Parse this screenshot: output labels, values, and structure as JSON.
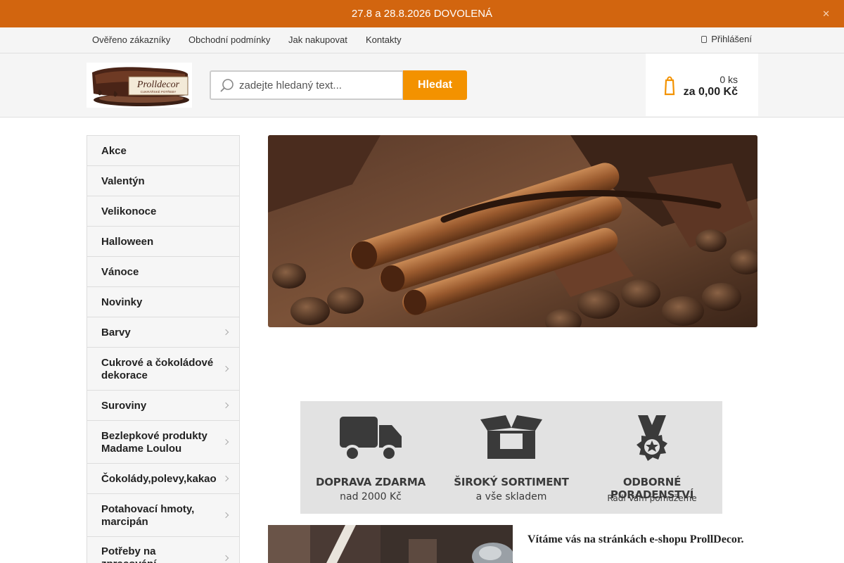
{
  "announcement": {
    "text": "27.8 a 28.8.2026 DOVOLENÁ",
    "close_icon": "close-icon"
  },
  "topnav": {
    "links": [
      "Ověřeno zákazníky",
      "Obchodní podmínky",
      "Jak nakupovat",
      "Kontakty"
    ],
    "login_label": "Přihlášení"
  },
  "header": {
    "logo_text": "Prolldecor",
    "logo_tagline": "CUKRÁŘSKÉ POTŘEBY",
    "search_placeholder": "zadejte hledaný text...",
    "search_button": "Hledat",
    "cart_qty": "0 ks",
    "cart_total": "za 0,00 Kč"
  },
  "sidebar": {
    "items": [
      {
        "label": "Akce",
        "has_sub": false
      },
      {
        "label": "Valentýn",
        "has_sub": false
      },
      {
        "label": "Velikonoce",
        "has_sub": false
      },
      {
        "label": "Halloween",
        "has_sub": false
      },
      {
        "label": "Vánoce",
        "has_sub": false
      },
      {
        "label": "Novinky",
        "has_sub": false
      },
      {
        "label": "Barvy",
        "has_sub": true
      },
      {
        "label": "Cukrové a čokoládové dekorace",
        "has_sub": true
      },
      {
        "label": "Suroviny",
        "has_sub": true
      },
      {
        "label": "Bezlepkové produkty Madame Loulou",
        "has_sub": true
      },
      {
        "label": "Čokolády,polevy,kakao",
        "has_sub": true
      },
      {
        "label": "Potahovací hmoty, marcipán",
        "has_sub": true
      },
      {
        "label": "Potřeby na zpracování",
        "has_sub": true
      }
    ]
  },
  "benefits": [
    {
      "title": "DOPRAVA ZDARMA",
      "subtitle": "nad 2000 Kč",
      "icon": "truck-icon"
    },
    {
      "title": "ŠIROKÝ SORTIMENT",
      "subtitle": "a vše skladem",
      "icon": "box-icon"
    },
    {
      "title": "ODBORNÉ PORADENSTVÍ",
      "subtitle": "Rádi Vám pomůžeme",
      "icon": "medal-icon"
    }
  ],
  "welcome_text": "Vítáme vás na stránkách e-shopu ProllDecor.",
  "colors": {
    "accent": "#f39200",
    "announcement_bg": "#d2650f"
  }
}
